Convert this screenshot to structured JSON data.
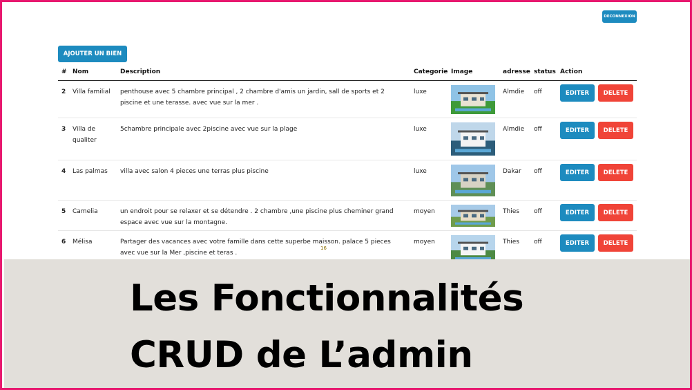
{
  "header": {
    "logout_label": "DECONNEXION"
  },
  "toolbar": {
    "add_label": "AJOUTER UN BIEN"
  },
  "table": {
    "columns": [
      "#",
      "Nom",
      "Description",
      "Categorie",
      "Image",
      "adresse",
      "status",
      "Action"
    ],
    "rows": [
      {
        "id": "2",
        "nom": "Villa familial",
        "description": "penthouse avec 5 chambre principal , 2 chambre d'amis un jardin, sall de sports et 2 piscine et une terasse. avec vue sur la mer .",
        "categorie": "luxe",
        "adresse": "Almdie",
        "status": "off",
        "image": "villa-photo"
      },
      {
        "id": "3",
        "nom": "Villa de qualiter",
        "description": "5chambre principale avec 2piscine avec vue sur la plage",
        "categorie": "luxe",
        "adresse": "Almdie",
        "status": "off",
        "image": "villa-photo"
      },
      {
        "id": "4",
        "nom": "Las palmas",
        "description": "villa avec salon 4 pieces une terras plus piscine",
        "categorie": "luxe",
        "adresse": "Dakar",
        "status": "off",
        "image": "villa-photo"
      },
      {
        "id": "5",
        "nom": "Camelia",
        "description": "un endroit pour se relaxer et se détendre . 2 chambre ,une piscine plus cheminer grand espace avec vue sur la montagne.",
        "categorie": "moyen",
        "adresse": "Thies",
        "status": "off",
        "image": "villa-photo"
      },
      {
        "id": "6",
        "nom": "Mélisa",
        "description": "Partager des vacances avec votre famille dans cette superbe maisson. palace 5 pieces avec vue sur la Mer ,piscine et teras .",
        "categorie": "moyen",
        "adresse": "Thies",
        "status": "off",
        "image": "villa-photo"
      }
    ],
    "edit_label": "EDITER",
    "delete_label": "DELETE"
  },
  "page_number": "16",
  "banner": {
    "line1": "Les Fonctionnalités",
    "line2": "CRUD de L’admin"
  },
  "colors": {
    "border": "#e8186f",
    "primary": "#1d8bbf",
    "danger": "#f04438",
    "band": "#e2dfda"
  }
}
